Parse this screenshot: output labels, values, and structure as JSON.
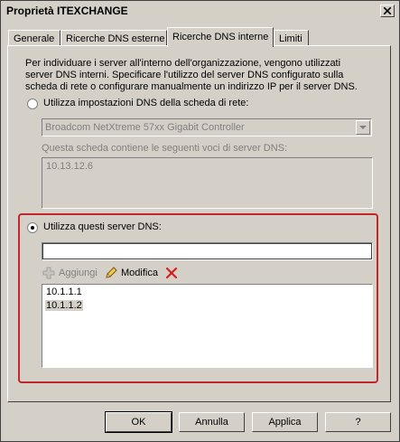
{
  "window": {
    "title": "Proprietà ITEXCHANGE"
  },
  "tabs": [
    {
      "label": "Generale",
      "active": false
    },
    {
      "label": "Ricerche DNS esterne",
      "active": false
    },
    {
      "label": "Ricerche DNS interne",
      "active": true
    },
    {
      "label": "Limiti",
      "active": false
    }
  ],
  "panel": {
    "description": "Per individuare i server all'interno dell'organizzazione, vengono utilizzati server DNS interni. Specificare l'utilizzo del server DNS configurato sulla scheda di rete o configurare manualmente un indirizzo IP per il server DNS.",
    "adapter_option": {
      "label": "Utilizza impostazioni DNS della scheda di rete:",
      "selected": false,
      "adapter_select_value": "Broadcom NetXtreme 57xx Gigabit Controller",
      "servers_caption": "Questa scheda contiene le seguenti voci di server DNS:",
      "servers": [
        "10.13.12.6"
      ]
    },
    "custom_option": {
      "label": "Utilizza questi server DNS:",
      "selected": true,
      "input_value": "",
      "add_label": "Aggiungi",
      "edit_label": "Modifica",
      "servers": [
        "10.1.1.1",
        "10.1.1.2"
      ],
      "selected_server_index": 1
    }
  },
  "buttons": {
    "ok": "OK",
    "cancel": "Annulla",
    "apply": "Applica",
    "help": "?"
  },
  "colors": {
    "highlight_frame": "#c0262c",
    "dialog_face": "#d4d0c8"
  }
}
